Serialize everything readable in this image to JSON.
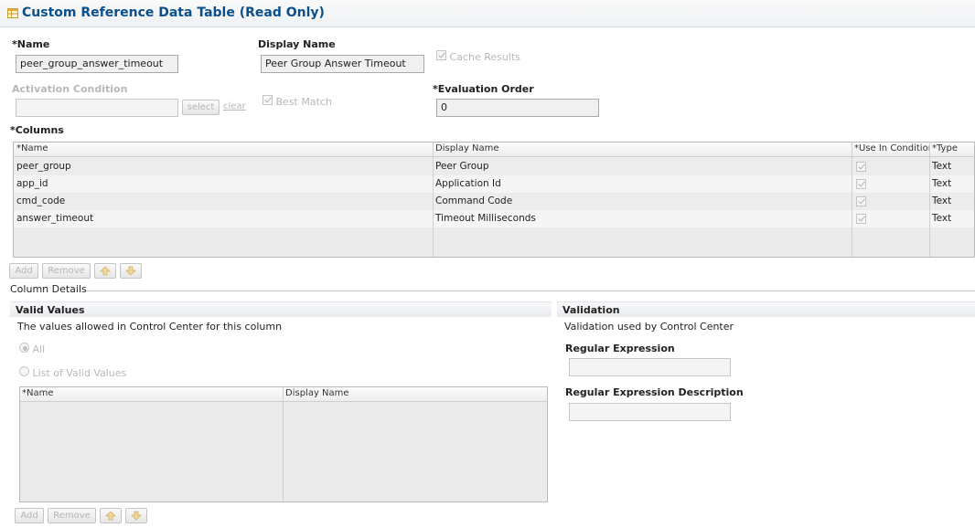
{
  "header": {
    "title": "Custom Reference Data Table (Read Only)"
  },
  "form": {
    "name_label": "*Name",
    "name_value": "peer_group_answer_timeout",
    "display_name_label": "Display Name",
    "display_name_value": "Peer Group Answer Timeout",
    "cache_results_label": "Cache Results",
    "activation_condition_label": "Activation Condition",
    "activation_condition_value": "",
    "select_label": "select",
    "clear_label": "clear",
    "best_match_label": "Best Match",
    "evaluation_order_label": "*Evaluation Order",
    "evaluation_order_value": "0"
  },
  "columns": {
    "label": "*Columns",
    "headers": [
      "*Name",
      "Display Name",
      "*Use In Conditions",
      "*Type"
    ],
    "rows": [
      {
        "name": "peer_group",
        "display": "Peer Group",
        "type": "Text"
      },
      {
        "name": "app_id",
        "display": "Application Id",
        "type": "Text"
      },
      {
        "name": "cmd_code",
        "display": "Command Code",
        "type": "Text"
      },
      {
        "name": "answer_timeout",
        "display": "Timeout Milliseconds",
        "type": "Text"
      }
    ],
    "add_label": "Add",
    "remove_label": "Remove"
  },
  "column_details": {
    "label": "Column Details",
    "valid_values": {
      "title": "Valid Values",
      "description": "The values allowed in Control Center for this column",
      "option_all": "All",
      "option_list": "List of Valid Values",
      "headers": [
        "*Name",
        "Display Name"
      ],
      "add_label": "Add",
      "remove_label": "Remove"
    },
    "validation": {
      "title": "Validation",
      "description": "Validation used by Control Center",
      "regex_label": "Regular Expression",
      "regex_value": "",
      "regex_desc_label": "Regular Expression Description",
      "regex_desc_value": ""
    }
  }
}
